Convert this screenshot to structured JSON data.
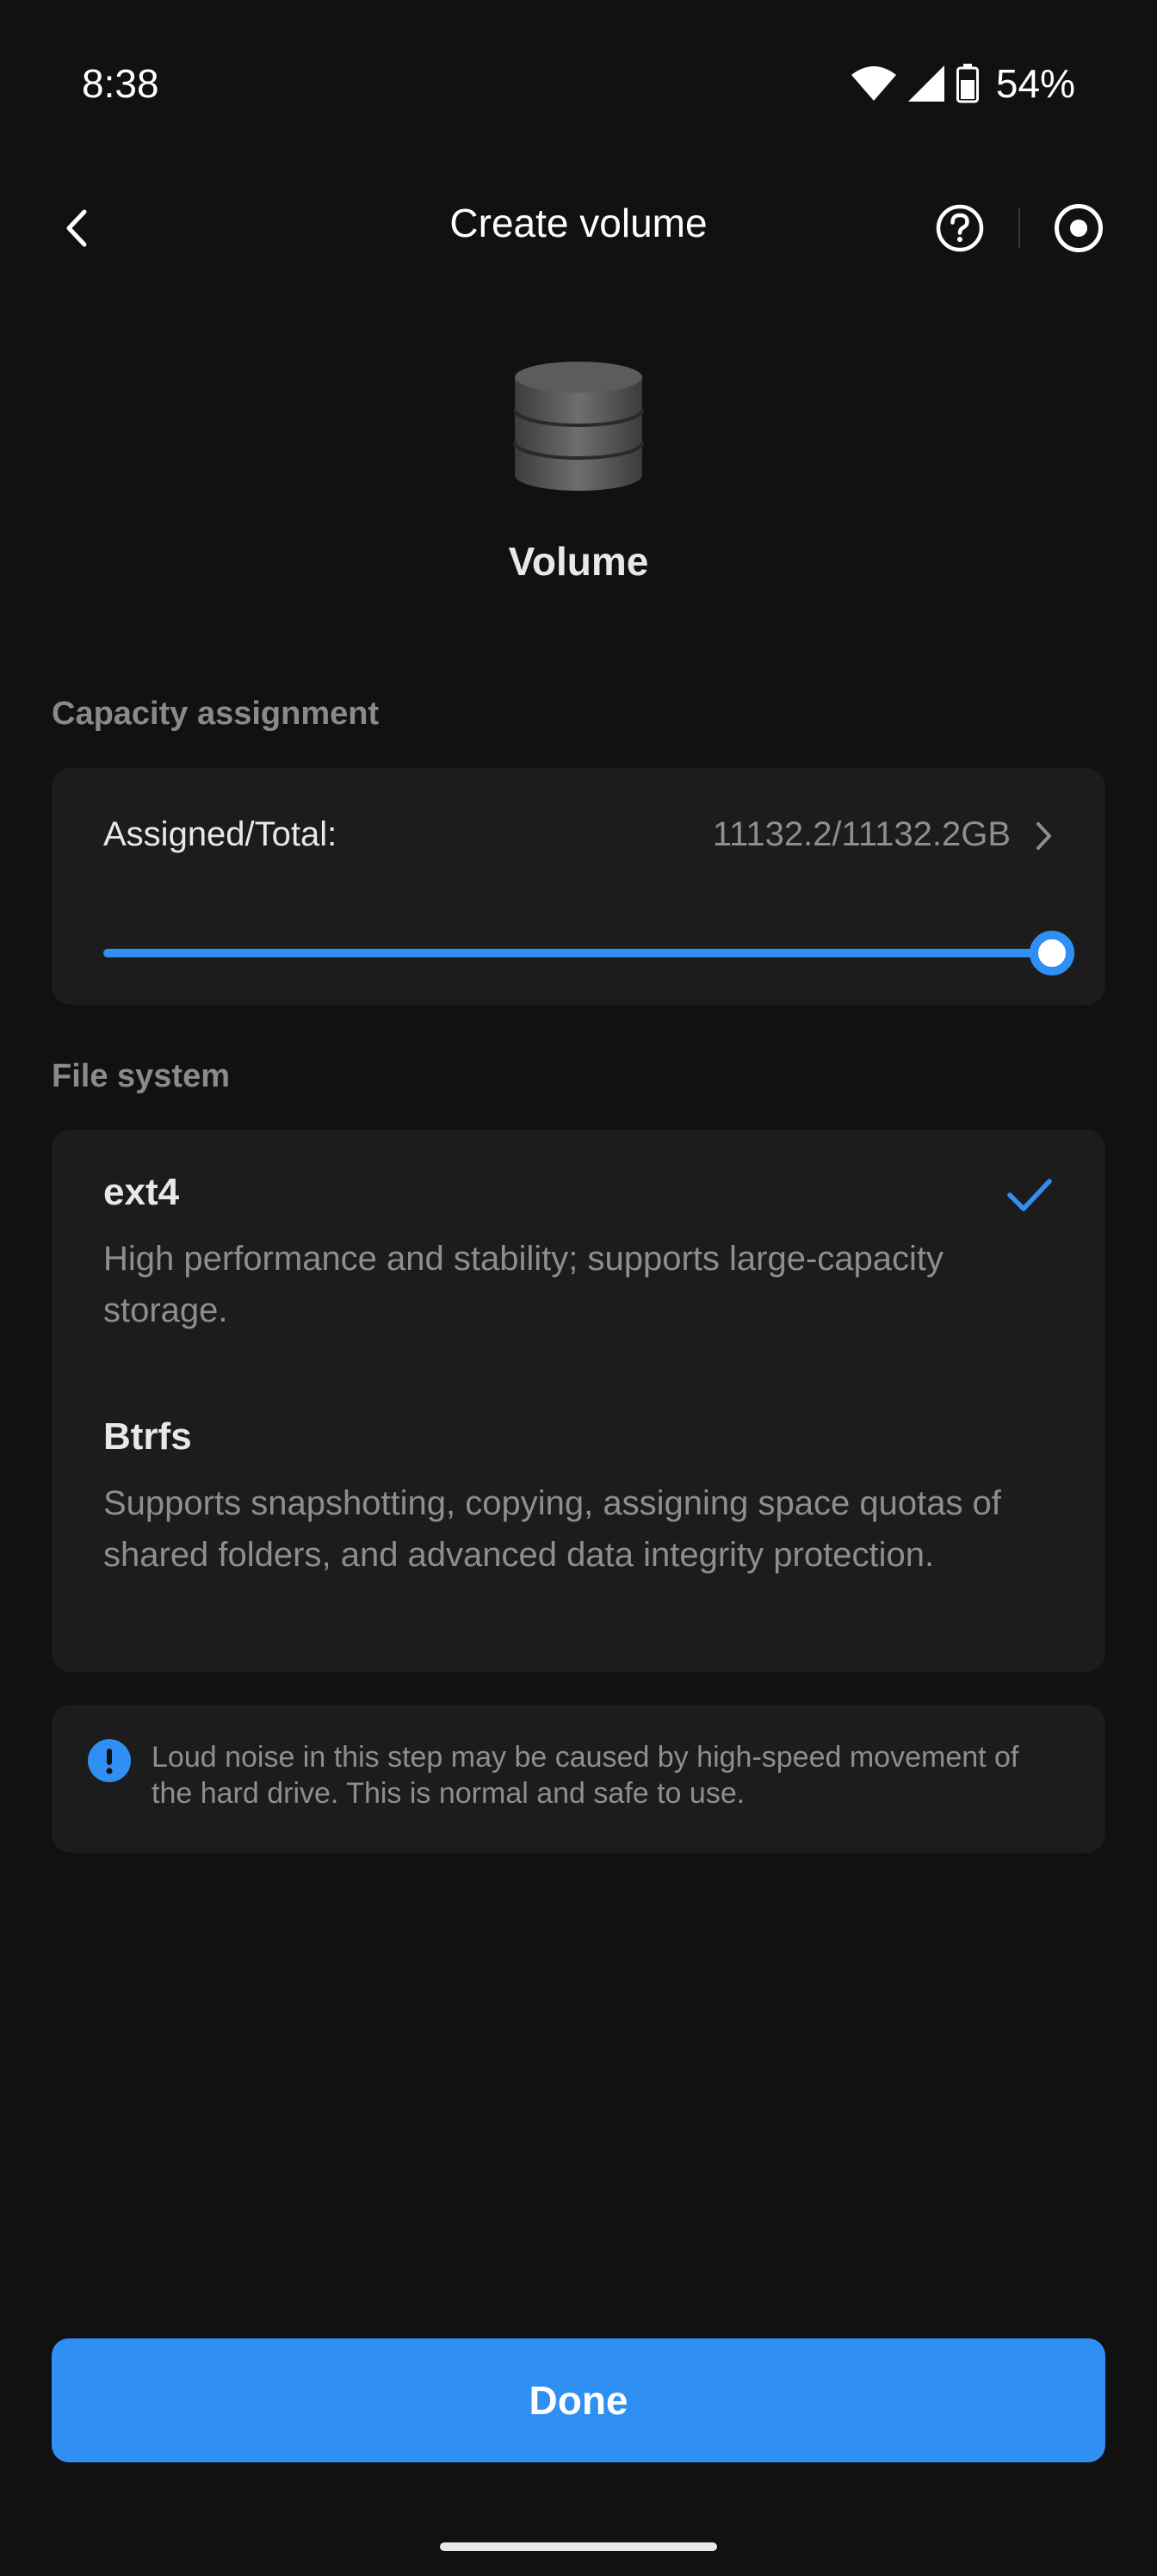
{
  "status_bar": {
    "time": "8:38",
    "battery_percent": "54%"
  },
  "header": {
    "title": "Create volume",
    "back_icon": "chevron-left-icon",
    "help_icon": "help-circle-icon",
    "record_icon": "record-icon"
  },
  "hero": {
    "icon": "database-icon",
    "label": "Volume"
  },
  "capacity": {
    "section_label": "Capacity assignment",
    "label": "Assigned/Total:",
    "value": "11132.2/11132.2GB",
    "slider_fraction": 1.0
  },
  "file_system": {
    "section_label": "File system",
    "options": [
      {
        "name": "ext4",
        "description": "High performance and stability; supports large-capacity storage.",
        "selected": true
      },
      {
        "name": "Btrfs",
        "description": "Supports snapshotting, copying, assigning space quotas of shared folders, and advanced data integrity protection.",
        "selected": false
      }
    ]
  },
  "notice": {
    "icon": "info-icon",
    "text": "Loud noise in this step may be caused by high-speed movement of the hard drive. This is normal and safe to use."
  },
  "done_label": "Done",
  "colors": {
    "accent": "#2f8ff2",
    "background": "#111111",
    "card": "#1c1c1c"
  }
}
